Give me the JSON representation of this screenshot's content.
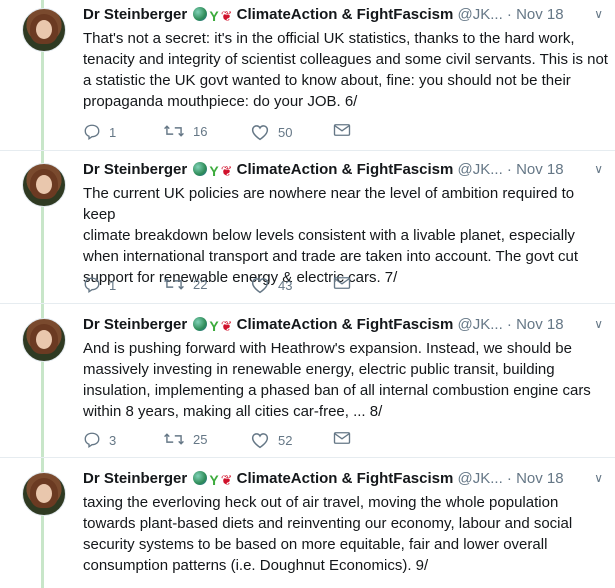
{
  "tweets": [
    {
      "author": "Dr Steinberger",
      "handle": "ClimateAction & FightFascism",
      "handle_suffix": "@JK...",
      "date": "Nov 18",
      "text": "That's not a secret: it's in the official UK statistics, thanks to the hard work,\ntenacity and integrity of scientist colleagues and some civil servants. This is not\na statistic the UK govt wanted to know about, fine: you should not be their\npropaganda mouthpiece: do your JOB. 6/",
      "replies": "1",
      "retweets": "16",
      "likes": "50"
    },
    {
      "author": "Dr Steinberger",
      "handle": "ClimateAction & FightFascism",
      "handle_suffix": "@JK...",
      "date": "Nov 18",
      "text": "The current UK policies are nowhere near the level of ambition required to keep\nclimate breakdown below levels consistent with a livable planet, especially\nwhen international transport and trade are taken into account. The govt cut\nsupport for renewable energy & electric cars. 7/",
      "replies": "1",
      "retweets": "22",
      "likes": "43"
    },
    {
      "author": "Dr Steinberger",
      "handle": "ClimateAction & FightFascism",
      "handle_suffix": "@JK...",
      "date": "Nov 18",
      "text": "And is pushing forward with Heathrow's expansion. Instead, we should be\nmassively investing in renewable energy, electric public transit, building\ninsulation, implementing a phased ban of all internal combustion engine cars\nwithin 8 years, making all cities car-free, ... 8/",
      "replies": "3",
      "retweets": "25",
      "likes": "52"
    },
    {
      "author": "Dr Steinberger",
      "handle": "ClimateAction & FightFascism",
      "handle_suffix": "@JK...",
      "date": "Nov 18",
      "text": "taxing the everloving heck out of air travel, moving the whole population\ntowards plant-based diets and reinventing our economy, labour and social\nsecurity systems to be based on more equitable, fair and lower overall\nconsumption patterns (i.e. Doughnut Economics). 9/",
      "replies": "",
      "retweets": "",
      "likes": ""
    }
  ],
  "colors": {
    "thread_line": "#c8e6c9",
    "text": "#14171a",
    "muted": "#657786"
  },
  "icons": [
    "reply-icon",
    "retweet-icon",
    "like-icon",
    "message-icon",
    "chevron-down-icon"
  ]
}
